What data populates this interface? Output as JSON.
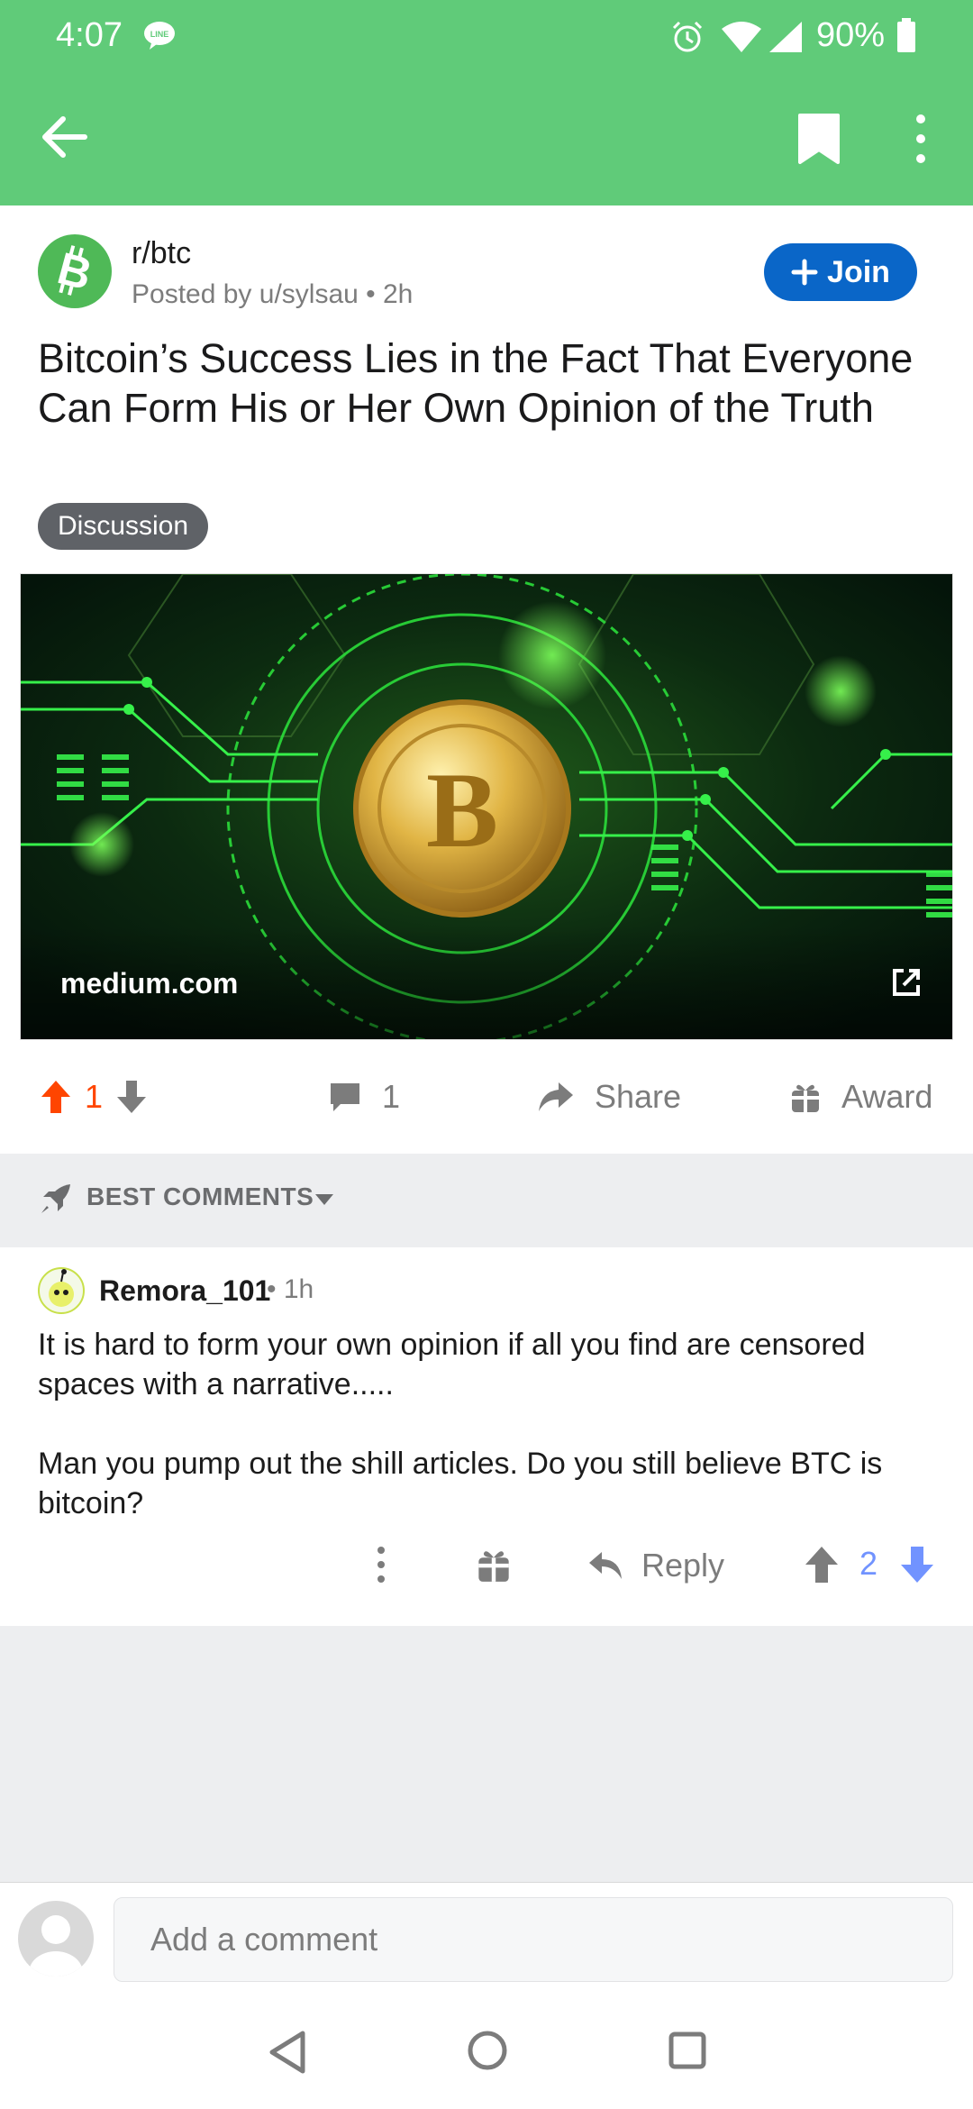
{
  "status_bar": {
    "time": "4:07",
    "battery": "90%"
  },
  "app_bar": {
    "back_icon": "arrow-left-icon",
    "bookmark_icon": "bookmark-icon",
    "more_icon": "more-vertical-icon"
  },
  "post": {
    "subreddit": "r/btc",
    "posted_by": "Posted by u/sylsau",
    "age": "2h",
    "join_label": "Join",
    "title": "Bitcoin’s Success Lies in the Fact That Everyone Can Form His or Her Own Opinion of the Truth",
    "flair": "Discussion",
    "link_domain": "medium.com",
    "upvotes": "1",
    "comments": "1",
    "share_label": "Share",
    "award_label": "Award"
  },
  "sort": {
    "label": "BEST COMMENTS"
  },
  "comment": {
    "username": "Remora_101",
    "age": "1h",
    "paragraphs": [
      "It is hard to form your own opinion if all you find are censored spaces with a narrative.....",
      "Man you pump out the shill articles. Do you still believe BTC is bitcoin?"
    ],
    "reply_label": "Reply",
    "score": "2"
  },
  "composer": {
    "placeholder": "Add a comment"
  },
  "colors": {
    "header_green": "#60cb79",
    "join_blue": "#0a66c8",
    "upvote_orange": "#ff4500",
    "downvote_blue": "#7193ff"
  }
}
